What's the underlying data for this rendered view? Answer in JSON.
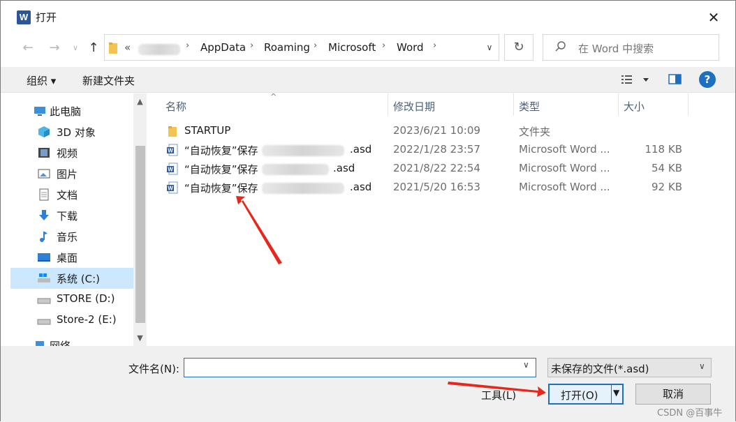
{
  "window": {
    "title": "打开",
    "app_icon_letter": "W"
  },
  "address": {
    "prefix": "«",
    "crumbs": [
      "AppData",
      "Roaming",
      "Microsoft",
      "Word"
    ],
    "search_placeholder": "在 Word 中搜索"
  },
  "toolbar": {
    "organize": "组织 ▾",
    "new_folder": "新建文件夹",
    "help": "?"
  },
  "nav": {
    "items": [
      "此电脑",
      "3D 对象",
      "视频",
      "图片",
      "文档",
      "下载",
      "音乐",
      "桌面",
      "系统 (C:)",
      "STORE (D:)",
      "Store-2 (E:)",
      "网络"
    ],
    "selected": "系统 (C:)"
  },
  "list": {
    "columns": [
      "名称",
      "修改日期",
      "类型",
      "大小"
    ],
    "rows": [
      {
        "name": "STARTUP",
        "date": "2023/6/21 10:09",
        "type": "文件夹",
        "size": "",
        "icon": "folder-icon"
      },
      {
        "name": "“自动恢复”保存",
        "suffix": ".asd",
        "date": "2022/1/28 23:57",
        "type": "Microsoft Word ...",
        "size": "118 KB",
        "icon": "word-doc-icon"
      },
      {
        "name": "“自动恢复”保存",
        "suffix": ".asd",
        "date": "2021/8/22 22:54",
        "type": "Microsoft Word ...",
        "size": "54 KB",
        "icon": "word-doc-icon"
      },
      {
        "name": "“自动恢复”保存",
        "suffix": ".asd",
        "date": "2021/5/20 16:53",
        "type": "Microsoft Word ...",
        "size": "92 KB",
        "icon": "word-doc-icon"
      }
    ]
  },
  "bottom": {
    "filename_label": "文件名(N):",
    "filename_value": "",
    "filetype": "未保存的文件(*.asd)",
    "tools": "工具(L)",
    "open": "打开(O)",
    "cancel": "取消"
  },
  "watermark": "CSDN @百事牛",
  "colors": {
    "accent": "#1f6fc1",
    "selection": "#cce8ff",
    "arrow": "#e8271c"
  }
}
